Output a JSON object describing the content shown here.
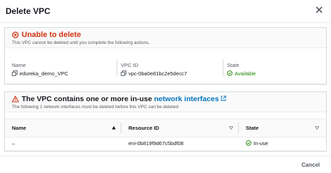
{
  "modal": {
    "title": "Delete VPC"
  },
  "error_panel": {
    "title": "Unable to delete",
    "description": "This VPC cannot be deleted until you complete the following actions."
  },
  "vpc": {
    "name_label": "Name",
    "name_value": "edureka_demo_VPC",
    "id_label": "VPC ID",
    "id_value": "vpc-0ba0e81bc2e5decc7",
    "state_label": "State",
    "state_value": "Available"
  },
  "interfaces_panel": {
    "title_prefix": "The VPC contains one or more in-use ",
    "title_link": "network interfaces",
    "description": "The following 1 network interfaces must be deleted before this VPC can be deleted:",
    "columns": [
      "Name",
      "Resource ID",
      "State"
    ],
    "rows": [
      {
        "name": "–",
        "resource_id": "eni-0b819f9d67c5bdf08",
        "state": "In-use"
      }
    ]
  },
  "footer": {
    "cancel_label": "Cancel"
  },
  "colors": {
    "error": "#d13212",
    "link": "#0073bb",
    "success": "#1d8102"
  }
}
